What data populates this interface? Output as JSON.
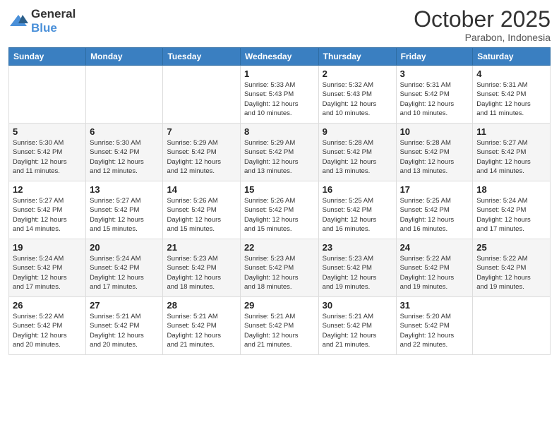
{
  "logo": {
    "text_general": "General",
    "text_blue": "Blue"
  },
  "title": "October 2025",
  "subtitle": "Parabon, Indonesia",
  "days_of_week": [
    "Sunday",
    "Monday",
    "Tuesday",
    "Wednesday",
    "Thursday",
    "Friday",
    "Saturday"
  ],
  "weeks": [
    [
      {
        "day": "",
        "info": ""
      },
      {
        "day": "",
        "info": ""
      },
      {
        "day": "",
        "info": ""
      },
      {
        "day": "1",
        "info": "Sunrise: 5:33 AM\nSunset: 5:43 PM\nDaylight: 12 hours\nand 10 minutes."
      },
      {
        "day": "2",
        "info": "Sunrise: 5:32 AM\nSunset: 5:43 PM\nDaylight: 12 hours\nand 10 minutes."
      },
      {
        "day": "3",
        "info": "Sunrise: 5:31 AM\nSunset: 5:42 PM\nDaylight: 12 hours\nand 10 minutes."
      },
      {
        "day": "4",
        "info": "Sunrise: 5:31 AM\nSunset: 5:42 PM\nDaylight: 12 hours\nand 11 minutes."
      }
    ],
    [
      {
        "day": "5",
        "info": "Sunrise: 5:30 AM\nSunset: 5:42 PM\nDaylight: 12 hours\nand 11 minutes."
      },
      {
        "day": "6",
        "info": "Sunrise: 5:30 AM\nSunset: 5:42 PM\nDaylight: 12 hours\nand 12 minutes."
      },
      {
        "day": "7",
        "info": "Sunrise: 5:29 AM\nSunset: 5:42 PM\nDaylight: 12 hours\nand 12 minutes."
      },
      {
        "day": "8",
        "info": "Sunrise: 5:29 AM\nSunset: 5:42 PM\nDaylight: 12 hours\nand 13 minutes."
      },
      {
        "day": "9",
        "info": "Sunrise: 5:28 AM\nSunset: 5:42 PM\nDaylight: 12 hours\nand 13 minutes."
      },
      {
        "day": "10",
        "info": "Sunrise: 5:28 AM\nSunset: 5:42 PM\nDaylight: 12 hours\nand 13 minutes."
      },
      {
        "day": "11",
        "info": "Sunrise: 5:27 AM\nSunset: 5:42 PM\nDaylight: 12 hours\nand 14 minutes."
      }
    ],
    [
      {
        "day": "12",
        "info": "Sunrise: 5:27 AM\nSunset: 5:42 PM\nDaylight: 12 hours\nand 14 minutes."
      },
      {
        "day": "13",
        "info": "Sunrise: 5:27 AM\nSunset: 5:42 PM\nDaylight: 12 hours\nand 15 minutes."
      },
      {
        "day": "14",
        "info": "Sunrise: 5:26 AM\nSunset: 5:42 PM\nDaylight: 12 hours\nand 15 minutes."
      },
      {
        "day": "15",
        "info": "Sunrise: 5:26 AM\nSunset: 5:42 PM\nDaylight: 12 hours\nand 15 minutes."
      },
      {
        "day": "16",
        "info": "Sunrise: 5:25 AM\nSunset: 5:42 PM\nDaylight: 12 hours\nand 16 minutes."
      },
      {
        "day": "17",
        "info": "Sunrise: 5:25 AM\nSunset: 5:42 PM\nDaylight: 12 hours\nand 16 minutes."
      },
      {
        "day": "18",
        "info": "Sunrise: 5:24 AM\nSunset: 5:42 PM\nDaylight: 12 hours\nand 17 minutes."
      }
    ],
    [
      {
        "day": "19",
        "info": "Sunrise: 5:24 AM\nSunset: 5:42 PM\nDaylight: 12 hours\nand 17 minutes."
      },
      {
        "day": "20",
        "info": "Sunrise: 5:24 AM\nSunset: 5:42 PM\nDaylight: 12 hours\nand 17 minutes."
      },
      {
        "day": "21",
        "info": "Sunrise: 5:23 AM\nSunset: 5:42 PM\nDaylight: 12 hours\nand 18 minutes."
      },
      {
        "day": "22",
        "info": "Sunrise: 5:23 AM\nSunset: 5:42 PM\nDaylight: 12 hours\nand 18 minutes."
      },
      {
        "day": "23",
        "info": "Sunrise: 5:23 AM\nSunset: 5:42 PM\nDaylight: 12 hours\nand 19 minutes."
      },
      {
        "day": "24",
        "info": "Sunrise: 5:22 AM\nSunset: 5:42 PM\nDaylight: 12 hours\nand 19 minutes."
      },
      {
        "day": "25",
        "info": "Sunrise: 5:22 AM\nSunset: 5:42 PM\nDaylight: 12 hours\nand 19 minutes."
      }
    ],
    [
      {
        "day": "26",
        "info": "Sunrise: 5:22 AM\nSunset: 5:42 PM\nDaylight: 12 hours\nand 20 minutes."
      },
      {
        "day": "27",
        "info": "Sunrise: 5:21 AM\nSunset: 5:42 PM\nDaylight: 12 hours\nand 20 minutes."
      },
      {
        "day": "28",
        "info": "Sunrise: 5:21 AM\nSunset: 5:42 PM\nDaylight: 12 hours\nand 21 minutes."
      },
      {
        "day": "29",
        "info": "Sunrise: 5:21 AM\nSunset: 5:42 PM\nDaylight: 12 hours\nand 21 minutes."
      },
      {
        "day": "30",
        "info": "Sunrise: 5:21 AM\nSunset: 5:42 PM\nDaylight: 12 hours\nand 21 minutes."
      },
      {
        "day": "31",
        "info": "Sunrise: 5:20 AM\nSunset: 5:42 PM\nDaylight: 12 hours\nand 22 minutes."
      },
      {
        "day": "",
        "info": ""
      }
    ]
  ]
}
